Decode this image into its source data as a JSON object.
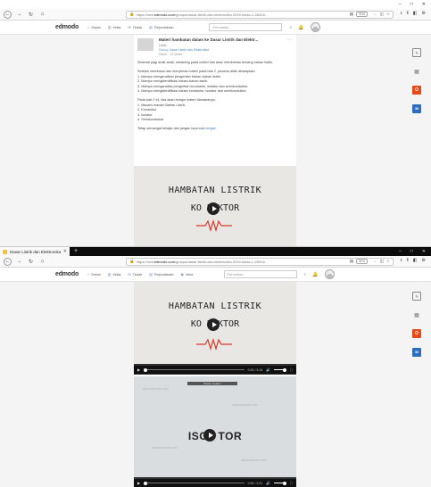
{
  "browser": {
    "tab_title": "Dasar Listrik dan Elektronika 20",
    "tab_close": "✕",
    "new_tab": "+",
    "url_prefix": "https://new.",
    "url_host": "edmodo.com",
    "url_path_1": "/groups/dasar-listrik-dan-elektronika-2019-kelas-1-28311/...",
    "url_path_2": "/groups/dasar-listrik-dan-elektronika-2019-kelas-1-28311/...",
    "zoom": "90%",
    "window_controls": [
      "–",
      "□",
      "✕"
    ]
  },
  "app": {
    "logo": "edmodo",
    "menu": [
      {
        "icon": "⌂",
        "label": "Depan"
      },
      {
        "icon": "▥",
        "label": "Kelas"
      },
      {
        "icon": "✉",
        "label": "Tindak"
      },
      {
        "icon": "▤",
        "label": "Perpustakaan"
      },
      {
        "icon": "◉",
        "label": "Inbox"
      }
    ],
    "search_placeholder": "Pencarian"
  },
  "post": {
    "title": "Materi hambatan dalam ke Dasar Listrik dan Elektr...",
    "sub": "Lebih",
    "to": "Guru ▸ Dasar Listrik dan Elektronika",
    "time": "Sabtu · 15 Maret ·",
    "more": "···",
    "para1": "Selamat pagi anak-anak, sekarang pada materi kita akan membahas tentang bahan listrik.",
    "para2": [
      "Setelah membaca dan menyimak materi pada bab 2, peserta didik diharapkan:",
      "1. Mampu mengenalkan pengertian bahan-bahan listrik.",
      "2. Mampu mengidentifikasi bahan-bahan listrik.",
      "3. Mampu menganalisa pengertian konduktor, isolator dan semikonduktor.",
      "4. Mampu mengidentifikasi bahan konduktor, isolator dan semikonduktor."
    ],
    "para3": [
      "Pada bab 2 ini, kita akan belajar materi diantaranya:",
      "1. Macam-macam Bahan Listrik",
      "2. Konduktor",
      "3. Isolator",
      "4. Semikonduktor"
    ],
    "para4_text": "Tetap semangat belajar dan jangan lupa cuci",
    "para4_link": "tangan"
  },
  "video1": {
    "line1": "HAMBATAN LISTRIK",
    "line2": "KO   DUKTOR",
    "time": "0:00 / 3:15"
  },
  "video2": {
    "title": "ISOL   TOR",
    "watermark": "www.edmodo.com",
    "band": "Bahan Isolator",
    "time": "0:00 / 2:21"
  },
  "side_tools": [
    {
      "name": "edit",
      "glyph": "✎"
    },
    {
      "name": "grid",
      "glyph": "▦"
    },
    {
      "name": "office",
      "glyph": "O"
    },
    {
      "name": "cal",
      "glyph": "30"
    }
  ],
  "colors": {
    "accent": "#4a87c5",
    "office": "#e64a19",
    "calendar": "#2d6fbd"
  }
}
